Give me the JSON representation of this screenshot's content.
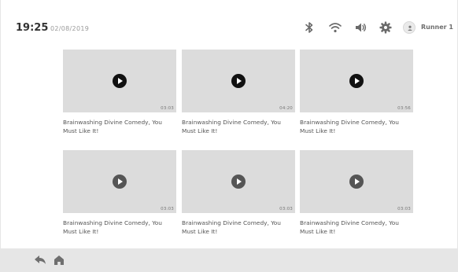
{
  "status": {
    "time": "19:25",
    "date": "02/08/2019",
    "username": "Runner 1",
    "icons": [
      "bluetooth-icon",
      "wifi-icon",
      "volume-icon",
      "settings-icon",
      "user-icon"
    ]
  },
  "videos": [
    {
      "title": "Brainwashing Divine Comedy, You Must Like It!",
      "duration": "03:03"
    },
    {
      "title": "Brainwashing Divine Comedy, You Must Like It!",
      "duration": "04:20"
    },
    {
      "title": "Brainwashing Divine Comedy, You Must Like It!",
      "duration": "03:56"
    },
    {
      "title": "Brainwashing Divine Comedy, You Must Like It!",
      "duration": "03:03"
    },
    {
      "title": "Brainwashing Divine Comedy, You Must Like It!",
      "duration": "03:03"
    },
    {
      "title": "Brainwashing Divine Comedy, You Must Like It!",
      "duration": "03:03"
    }
  ],
  "bottom_bar": {
    "icons": [
      "back-icon",
      "home-icon"
    ]
  },
  "colors": {
    "thumbnail": "#dcdcdc",
    "bottom_bar": "#e6e6e6",
    "play_active": "#111111",
    "play_inactive": "#555555"
  }
}
